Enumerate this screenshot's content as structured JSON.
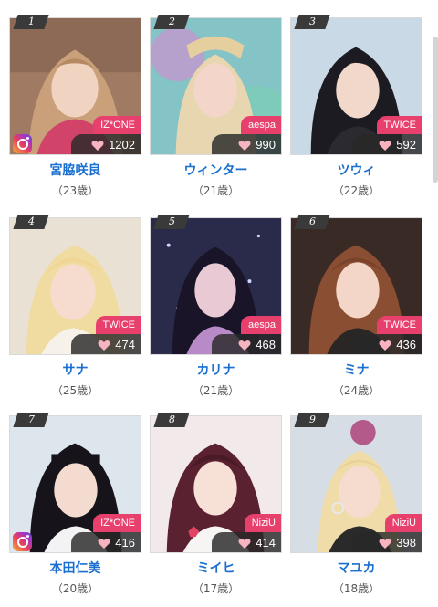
{
  "colors": {
    "name_blue": "#1a6fd0",
    "badge_pink": "#e8406d",
    "likes_bg": "#333333",
    "rank_bg": "#3a3a3a"
  },
  "cards": [
    {
      "rank": "1",
      "group": "IZ*ONE",
      "likes": "1202",
      "name": "宮脇咲良",
      "age": "（23歳）",
      "instagram": true
    },
    {
      "rank": "2",
      "group": "aespa",
      "likes": "990",
      "name": "ウィンター",
      "age": "（21歳）",
      "instagram": false
    },
    {
      "rank": "3",
      "group": "TWICE",
      "likes": "592",
      "name": "ツウィ",
      "age": "（22歳）",
      "instagram": false
    },
    {
      "rank": "4",
      "group": "TWICE",
      "likes": "474",
      "name": "サナ",
      "age": "（25歳）",
      "instagram": false
    },
    {
      "rank": "5",
      "group": "aespa",
      "likes": "468",
      "name": "カリナ",
      "age": "（21歳）",
      "instagram": false
    },
    {
      "rank": "6",
      "group": "TWICE",
      "likes": "436",
      "name": "ミナ",
      "age": "（24歳）",
      "instagram": false
    },
    {
      "rank": "7",
      "group": "IZ*ONE",
      "likes": "416",
      "name": "本田仁美",
      "age": "（20歳）",
      "instagram": true
    },
    {
      "rank": "8",
      "group": "NiziU",
      "likes": "414",
      "name": "ミイヒ",
      "age": "（17歳）",
      "instagram": false
    },
    {
      "rank": "9",
      "group": "NiziU",
      "likes": "398",
      "name": "マユカ",
      "age": "（18歳）",
      "instagram": false
    }
  ]
}
